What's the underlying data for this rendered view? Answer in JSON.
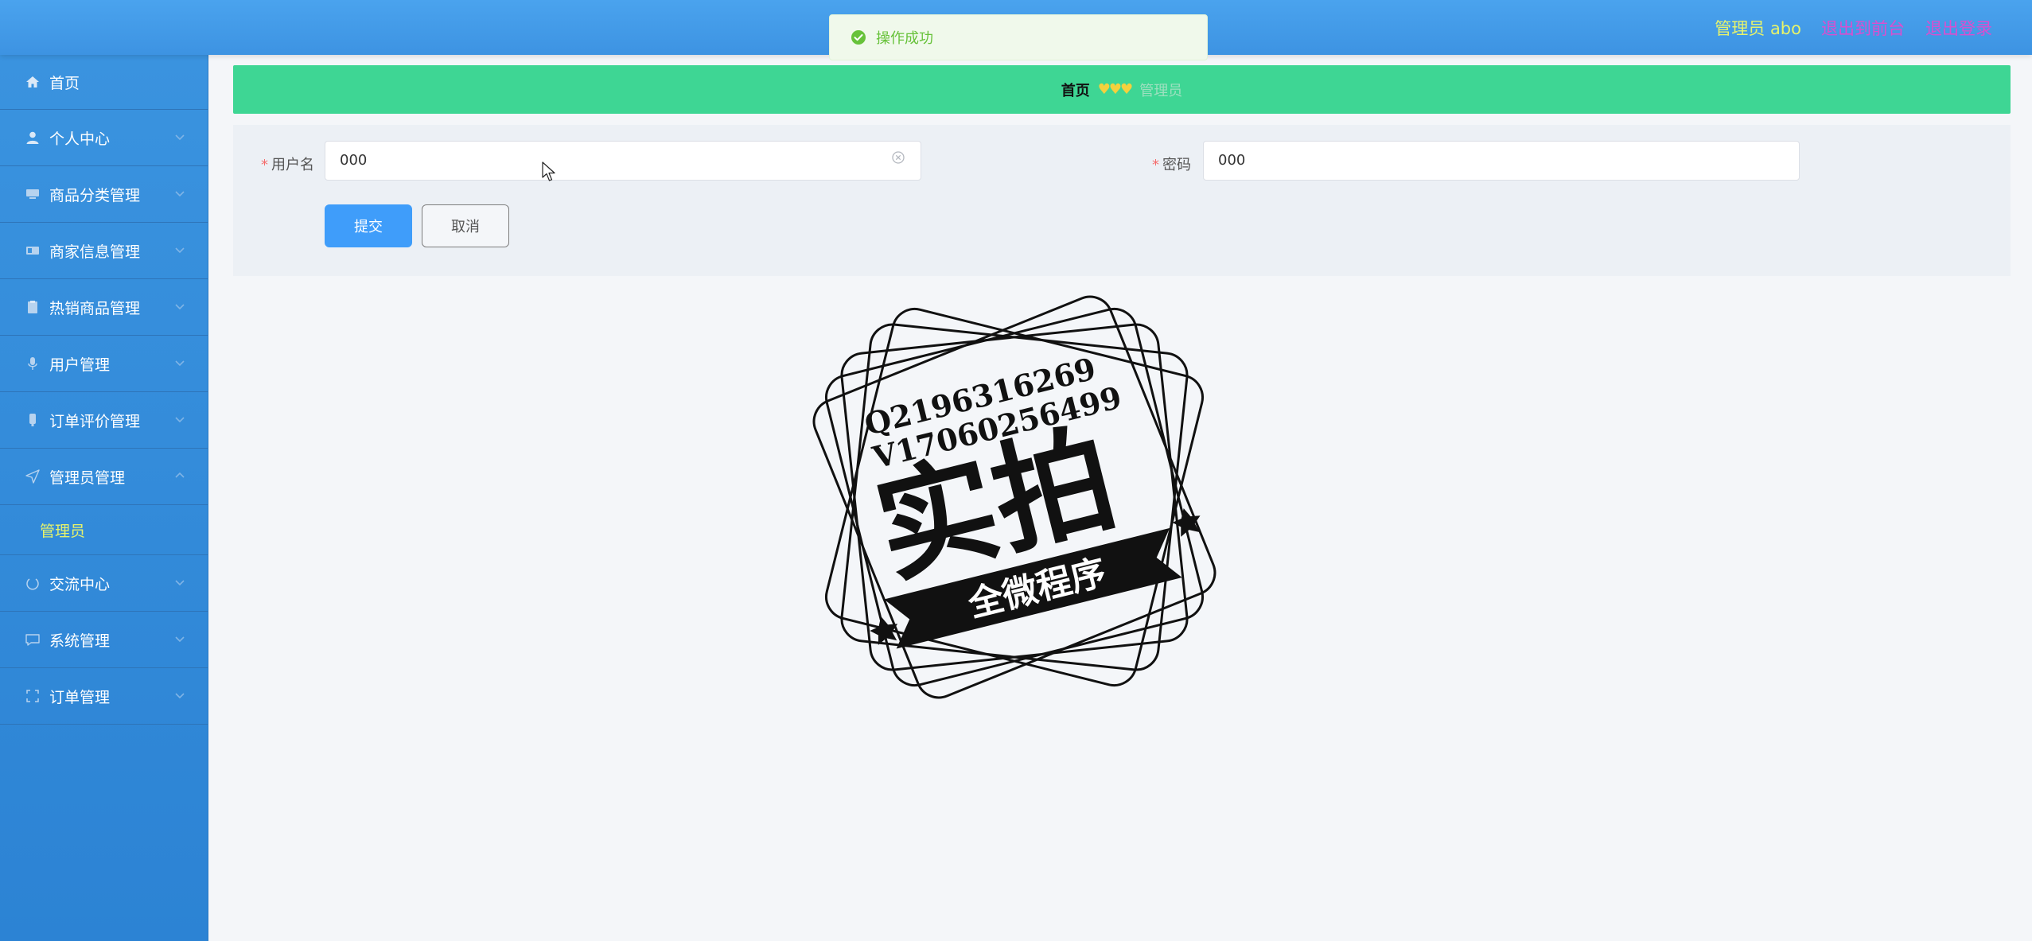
{
  "header": {
    "user_label": "管理员 abo",
    "back_to_front": "退出到前台",
    "logout": "退出登录"
  },
  "toast": {
    "message": "操作成功"
  },
  "sidebar": {
    "items": [
      {
        "label": "首页",
        "icon": "home-icon"
      },
      {
        "label": "个人中心",
        "icon": "user-icon"
      },
      {
        "label": "商品分类管理",
        "icon": "category-icon"
      },
      {
        "label": "商家信息管理",
        "icon": "store-icon"
      },
      {
        "label": "热销商品管理",
        "icon": "clipboard-icon"
      },
      {
        "label": "用户管理",
        "icon": "microphone-icon"
      },
      {
        "label": "订单评价管理",
        "icon": "comment-icon"
      },
      {
        "label": "管理员管理",
        "icon": "send-icon"
      },
      {
        "label": "交流中心",
        "icon": "power-icon"
      },
      {
        "label": "系统管理",
        "icon": "chat-icon"
      },
      {
        "label": "订单管理",
        "icon": "frame-icon"
      }
    ],
    "submenu_admin": "管理员"
  },
  "breadcrumb": {
    "home": "首页",
    "separator": "♥♥♥",
    "current": "管理员"
  },
  "form": {
    "username_label": "用户名",
    "username_value": "000",
    "password_label": "密码",
    "password_value": "000",
    "submit_label": "提交",
    "cancel_label": "取消"
  },
  "watermark": {
    "line1": "Q2196316269",
    "line2": "V17060256499",
    "main": "实拍",
    "ribbon": "全微程序"
  },
  "colors": {
    "topbar": "#4aa3ee",
    "sidebar": "#3a93df",
    "breadcrumb_bg": "#3ed694",
    "accent_yellow": "#e7f36b",
    "link_magenta": "#d94fcf",
    "primary_button": "#3f9dfa",
    "success_green": "#67c23a"
  }
}
